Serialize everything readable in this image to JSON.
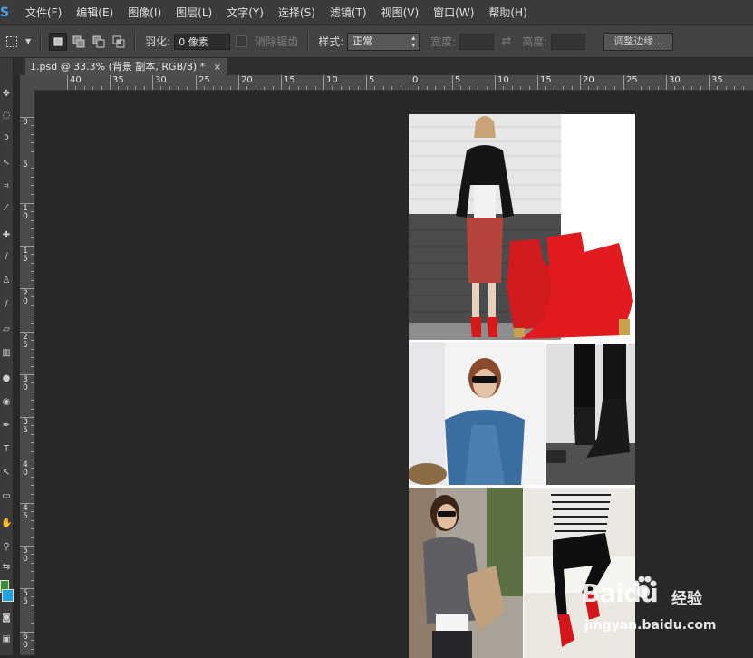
{
  "app": {
    "logo_text": "S"
  },
  "menu": [
    "文件(F)",
    "编辑(E)",
    "图像(I)",
    "图层(L)",
    "文字(Y)",
    "选择(S)",
    "滤镜(T)",
    "视图(V)",
    "窗口(W)",
    "帮助(H)"
  ],
  "options_bar": {
    "feather_label": "羽化:",
    "feather_value": "0 像素",
    "antialias_label": "消除锯齿",
    "style_label": "样式:",
    "style_value": "正常",
    "width_label": "宽度:",
    "height_label": "高度:",
    "refine_edge_button": "调整边缘..."
  },
  "document_tab": {
    "title": "1.psd @ 33.3% (背景 副本, RGB/8) *",
    "close": "×"
  },
  "ruler": {
    "horizontal_labels": [
      "40",
      "35",
      "30",
      "25",
      "20",
      "15",
      "10",
      "5",
      "0",
      "5",
      "10",
      "15",
      "20",
      "25",
      "30",
      "35"
    ],
    "vertical_labels": [
      "0",
      "5",
      "10",
      "15",
      "20",
      "25",
      "30",
      "35",
      "40",
      "45",
      "50",
      "55",
      "60"
    ]
  },
  "watermark": {
    "brand": "Baidu",
    "tag": "经验",
    "url": "jingyan.baidu.com"
  },
  "colors": {
    "accent": "#4aa4e8",
    "canvas_bg": "#282828",
    "panel_bg": "#424242",
    "boot_red": "#d8191c"
  }
}
